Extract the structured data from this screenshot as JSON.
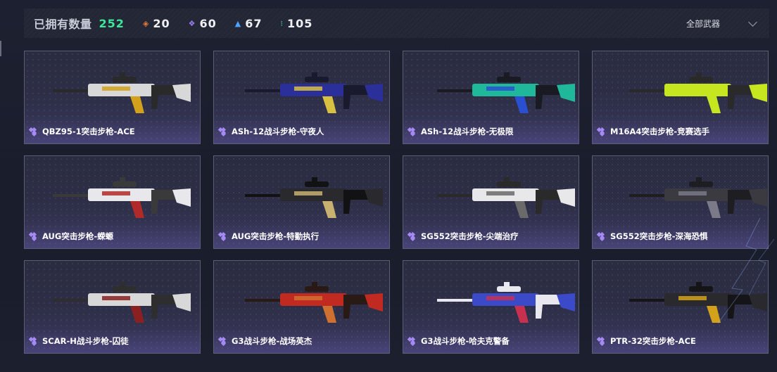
{
  "header": {
    "owned_label": "已拥有数量",
    "owned_count": "252",
    "stats": [
      {
        "icon": "orange-diamond-icon",
        "value": "20",
        "color": "#e8763a"
      },
      {
        "icon": "purple-diamond-icon",
        "value": "60",
        "color": "#9b7cf0"
      },
      {
        "icon": "blue-chevron-icon",
        "value": "67",
        "color": "#4aa3ff"
      },
      {
        "icon": "green-dots-icon",
        "value": "105",
        "color": "#3ee8b0"
      }
    ],
    "filter_label": "全部武器"
  },
  "cards": [
    {
      "name": "QBZ95-1突击步枪-ACE",
      "rarity": "purple",
      "palette": [
        "#d8d8d8",
        "#2a2a2a",
        "#d4a21a"
      ]
    },
    {
      "name": "ASh-12战斗步枪-守夜人",
      "rarity": "purple",
      "palette": [
        "#2a2f9a",
        "#1a1a2e",
        "#d8c040"
      ]
    },
    {
      "name": "ASh-12战斗步枪-无极限",
      "rarity": "purple",
      "palette": [
        "#1fb89a",
        "#1a1a22",
        "#2a4fd0"
      ]
    },
    {
      "name": "M16A4突击步枪-竞赛选手",
      "rarity": "purple",
      "palette": [
        "#c6e620",
        "#2a2a2a",
        "#c6e620"
      ]
    },
    {
      "name": "AUG突击步枪-蝾螈",
      "rarity": "purple",
      "palette": [
        "#e8e8ec",
        "#3a3a3a",
        "#b02a2a"
      ]
    },
    {
      "name": "AUG突击步枪-特勤执行",
      "rarity": "purple",
      "palette": [
        "#2a2a2e",
        "#121214",
        "#c8b070"
      ]
    },
    {
      "name": "SG552突击步枪-尖端治疗",
      "rarity": "purple",
      "palette": [
        "#e8e8ea",
        "#2a2a2a",
        "#6a6a6a"
      ]
    },
    {
      "name": "SG552突击步枪-深海恐惧",
      "rarity": "purple",
      "palette": [
        "#3a3a40",
        "#1e1e22",
        "#7a7a88"
      ]
    },
    {
      "name": "SCAR-H战斗步枪-囚徒",
      "rarity": "purple",
      "palette": [
        "#d8d8d8",
        "#2e2e2e",
        "#8a2020"
      ]
    },
    {
      "name": "G3战斗步枪-战场英杰",
      "rarity": "purple",
      "palette": [
        "#c02a20",
        "#2a1a16",
        "#d07030"
      ]
    },
    {
      "name": "G3战斗步枪-哈夫克警备",
      "rarity": "purple",
      "palette": [
        "#3a4ac8",
        "#e8e8ee",
        "#c83050"
      ]
    },
    {
      "name": "PTR-32突击步枪-ACE",
      "rarity": "purple",
      "palette": [
        "#2a2a2e",
        "#151517",
        "#d4a21a"
      ]
    }
  ]
}
